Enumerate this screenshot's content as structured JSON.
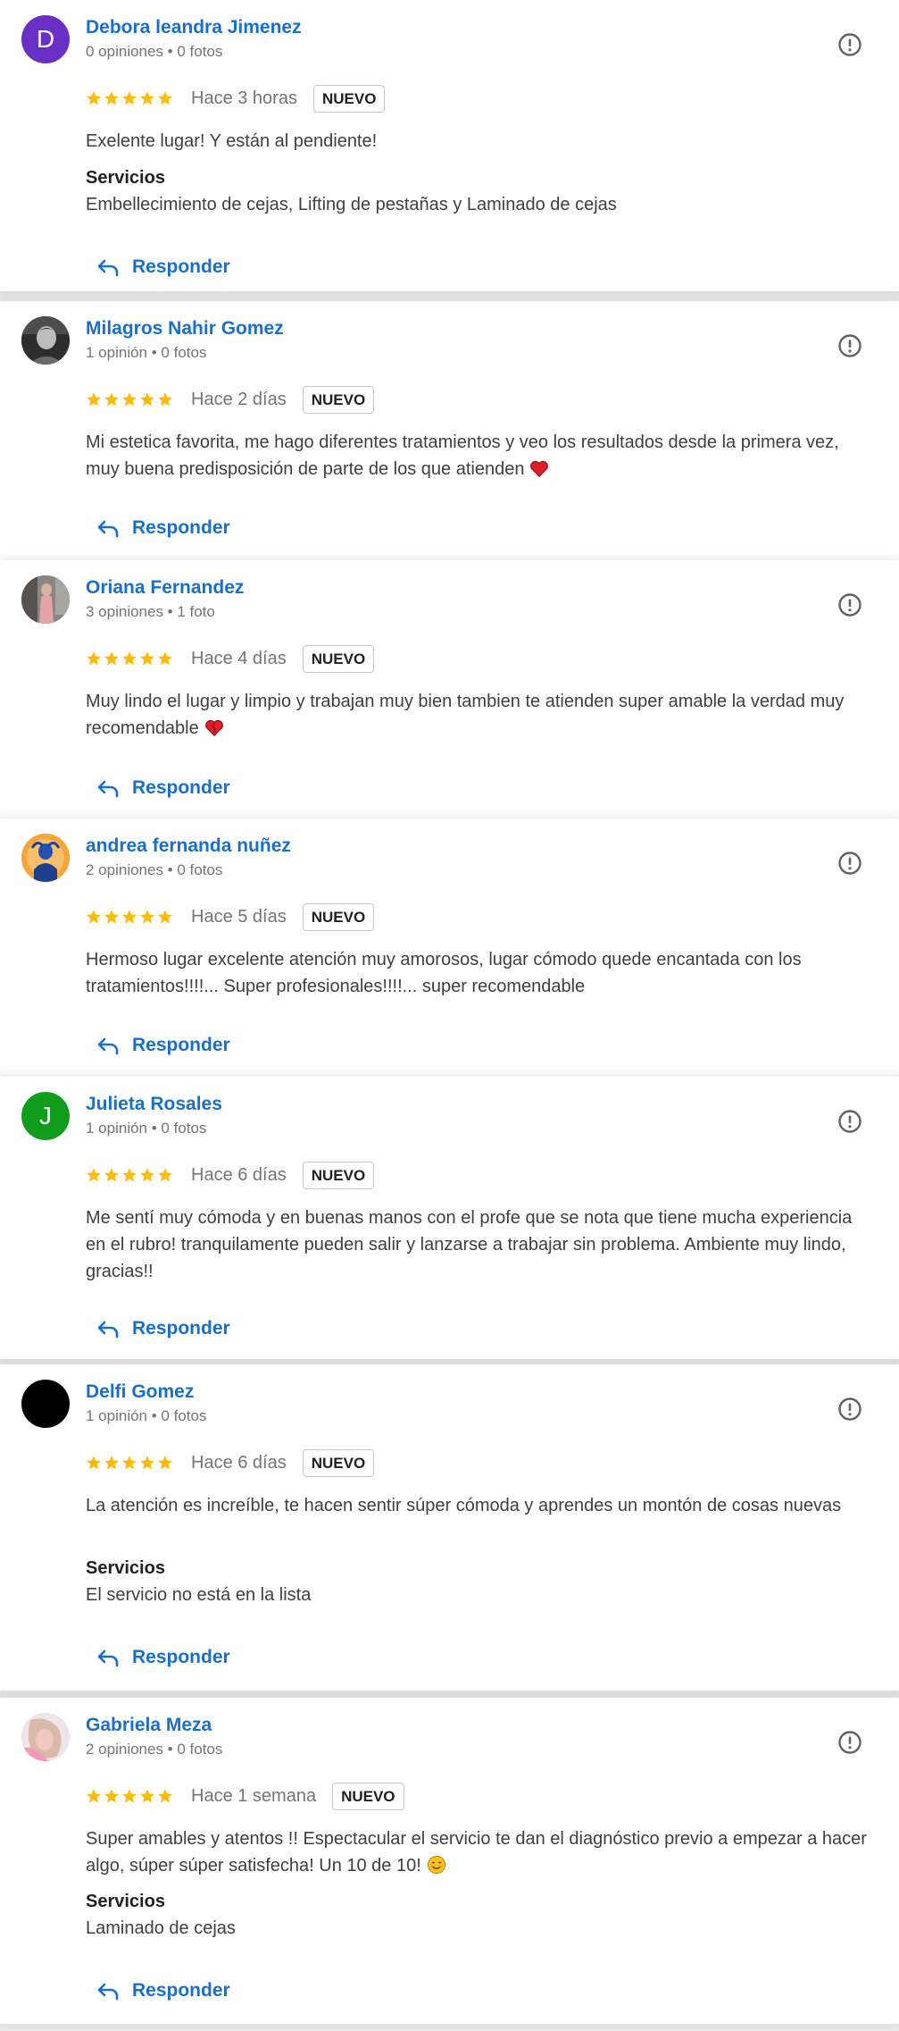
{
  "reviews": [
    {
      "name": "Debora leandra Jimenez",
      "meta": "0 opiniones • 0 fotos",
      "avatar_letter": "D",
      "avatar_color": "#6a2fc4",
      "time": "Hace 3 horas",
      "badge": "NUEVO",
      "text": "Exelente lugar! Y están al pendiente!",
      "services_label": "Servicios",
      "services": "Embellecimiento de cejas, Lifting de pestañas y Laminado de cejas",
      "reply": "Responder"
    },
    {
      "name": "Milagros Nahir Gomez",
      "meta": "1 opinión • 0 fotos",
      "time": "Hace 2 días",
      "badge": "NUEVO",
      "text": "Mi estetica favorita, me hago diferentes tratamientos y veo los resultados desde la primera vez, muy buena predisposición de parte de los que atienden",
      "emoji": "heart-icon",
      "reply": "Responder"
    },
    {
      "name": "Oriana Fernandez",
      "meta": "3 opiniones • 1 foto",
      "time": "Hace 4 días",
      "badge": "NUEVO",
      "text": "Muy lindo el lugar y limpio y trabajan muy bien tambien te atienden super amable la verdad muy recomendable",
      "emoji": "heart-icon",
      "reply": "Responder"
    },
    {
      "name": "andrea fernanda nuñez",
      "meta": "2 opiniones • 0 fotos",
      "time": "Hace 5 días",
      "badge": "NUEVO",
      "text": "Hermoso lugar excelente atención muy amorosos, lugar cómodo quede encantada con los tratamientos!!!!... Super profesionales!!!!... super recomendable",
      "reply": "Responder"
    },
    {
      "name": "Julieta Rosales",
      "meta": "1 opinión • 0 fotos",
      "avatar_letter": "J",
      "avatar_color": "#0f9d1b",
      "time": "Hace 6 días",
      "badge": "NUEVO",
      "text": "Me sentí muy cómoda y en buenas manos con el profe que se nota que tiene mucha experiencia en el rubro! tranquilamente pueden salir y lanzarse a trabajar sin problema. Ambiente muy lindo, gracias!!",
      "reply": "Responder"
    },
    {
      "name": "Delfi Gomez",
      "meta": "1 opinión • 0 fotos",
      "avatar_color": "#000000",
      "time": "Hace 6 días",
      "badge": "NUEVO",
      "text": "La atención es increíble, te hacen sentir súper cómoda y aprendes un montón de cosas nuevas",
      "services_label": "Servicios",
      "services": "El servicio no está en la lista",
      "reply": "Responder"
    },
    {
      "name": "Gabriela Meza",
      "meta": "2 opiniones • 0 fotos",
      "time": "Hace 1 semana",
      "badge": "NUEVO",
      "text": "Super amables y atentos !! Espectacular el servicio te dan el diagnóstico previo a empezar a hacer algo, súper súper satisfecha! Un 10 de 10!",
      "emoji": "smiling-face-icon",
      "services_label": "Servicios",
      "services": "Laminado de cejas",
      "reply": "Responder"
    }
  ],
  "rating_value": 5,
  "rating_max": 5,
  "colors": {
    "link": "#1a6fc7",
    "star": "#fbbc04",
    "muted": "#70757a"
  }
}
